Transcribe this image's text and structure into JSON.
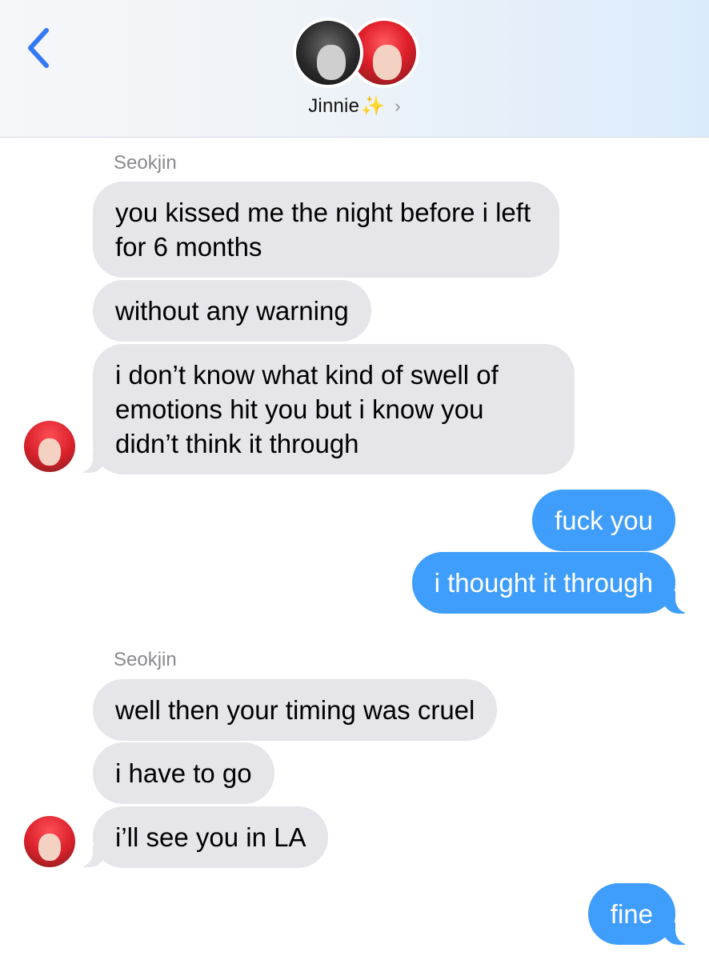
{
  "header": {
    "contact_name": "Jinnie",
    "sparkle": "✨",
    "chevron": "›",
    "back_icon": "chevron-left-icon"
  },
  "colors": {
    "incoming_bubble": "#e5e5ea",
    "outgoing_bubble": "#3f9dfb",
    "accent": "#3478f6"
  },
  "messages": {
    "group1_sender": "Seokjin",
    "m1": "you kissed me the night before i left for 6 months",
    "m2": "without any warning",
    "m3": "i don’t know what kind of swell of emotions hit you but i know you didn’t think it through",
    "m4": "fuck you",
    "m5": "i thought it through",
    "group2_sender": "Seokjin",
    "m6": "well then your timing was cruel",
    "m7": "i have to go",
    "m8": "i’ll see you in LA",
    "m9": "fine"
  }
}
